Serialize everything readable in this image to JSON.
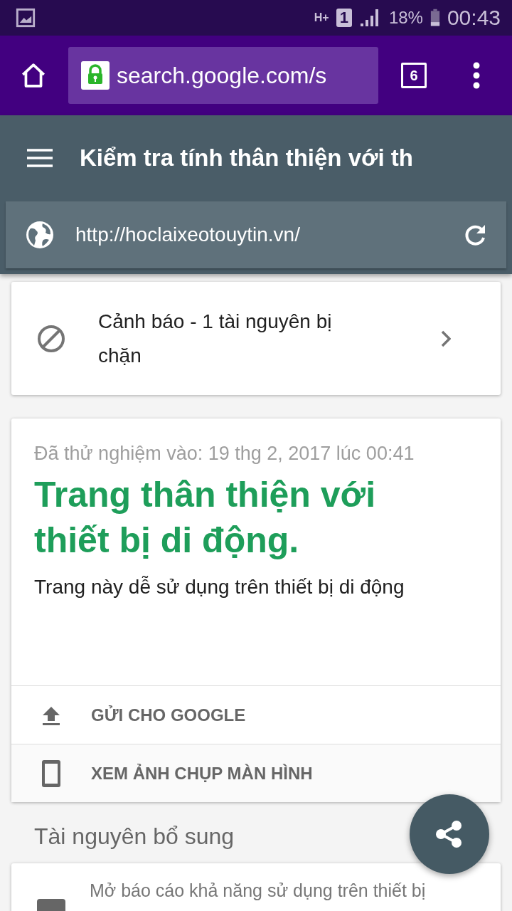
{
  "status_bar": {
    "network": "H+",
    "sim": "1",
    "battery": "18%",
    "time": "00:43"
  },
  "browser": {
    "url": "search.google.com/s",
    "tab_count": "6"
  },
  "header": {
    "title": "Kiểm tra tính thân thiện với th",
    "url": "http://hoclaixeotouytin.vn/"
  },
  "warning": {
    "text": "Cảnh báo - 1 tài nguyên bị chặn"
  },
  "result": {
    "tested": "Đã thử nghiệm vào: 19 thg 2, 2017 lúc 00:41",
    "headline": "Trang thân thiện với thiết bị di động.",
    "description": "Trang này dễ sử dụng trên thiết bị di động",
    "actions": [
      {
        "kind": "upload",
        "label": "GỬI CHO GOOGLE"
      },
      {
        "kind": "phone",
        "label": "XEM ẢNH CHỤP MÀN HÌNH"
      }
    ]
  },
  "resources": {
    "title": "Tài nguyên bổ sung",
    "items": [
      {
        "text": "Mở báo cáo khả năng sử dụng trên thiết bị"
      }
    ]
  }
}
